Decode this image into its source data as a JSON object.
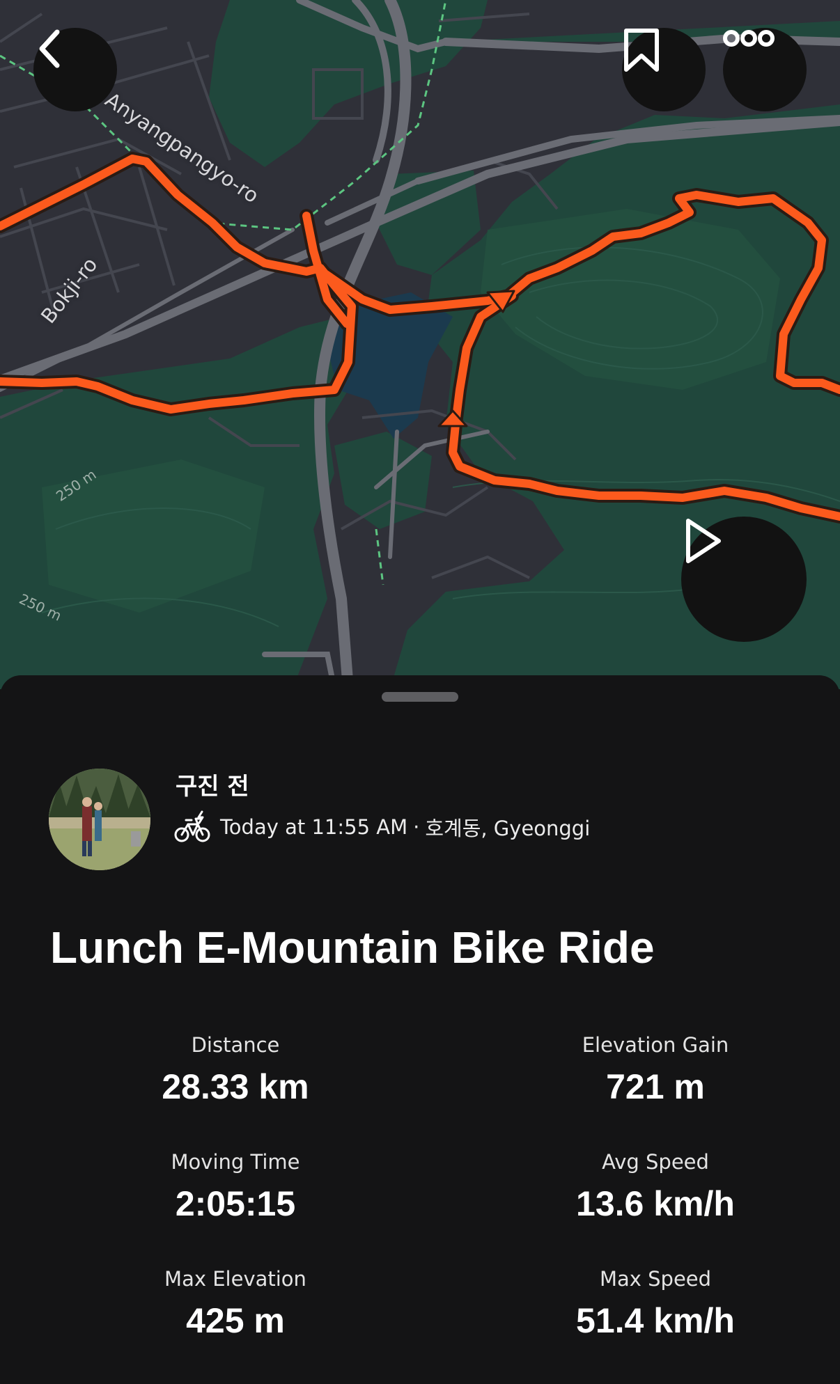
{
  "map": {
    "road_labels": [
      "Anyangpangyo-ro",
      "Bokji-ro"
    ],
    "contour_labels": [
      "250 m",
      "250 m"
    ],
    "route_color": "#fc5a1d",
    "forest_color": "#20473c",
    "urban_color": "#2f3038",
    "water_color": "#1b3a4e",
    "buttons": {
      "back": "chevron-left-icon",
      "bookmark": "bookmark-icon",
      "more": "more-dots-icon",
      "play": "play-icon"
    }
  },
  "activity": {
    "athlete_name": "구진 전",
    "sport_icon": "e-bike-icon",
    "datetime": "Today at 11:55 AM",
    "separator": "·",
    "location": "호계동, Gyeonggi",
    "title": "Lunch E-Mountain Bike Ride"
  },
  "stats": [
    {
      "label": "Distance",
      "value": "28.33 km"
    },
    {
      "label": "Elevation Gain",
      "value": "721 m"
    },
    {
      "label": "Moving Time",
      "value": "2:05:15"
    },
    {
      "label": "Avg Speed",
      "value": "13.6 km/h"
    },
    {
      "label": "Max Elevation",
      "value": "425 m"
    },
    {
      "label": "Max Speed",
      "value": "51.4 km/h"
    }
  ]
}
